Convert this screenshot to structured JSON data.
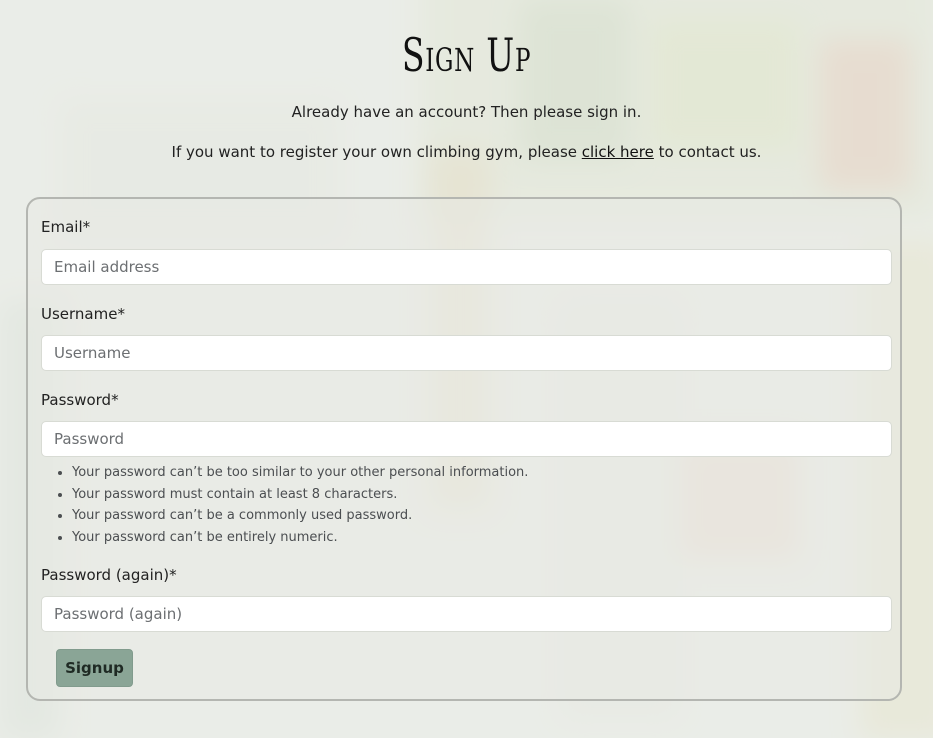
{
  "page": {
    "title": "Sign Up",
    "signin_prompt": "Already have an account? Then please sign in.",
    "gym_prefix": "If you want to register your own climbing gym, please ",
    "gym_link": "click here",
    "gym_suffix": " to contact us."
  },
  "form": {
    "email": {
      "label": "Email*",
      "placeholder": "Email address",
      "value": ""
    },
    "username": {
      "label": "Username*",
      "placeholder": "Username",
      "value": ""
    },
    "password": {
      "label": "Password*",
      "placeholder": "Password",
      "value": ""
    },
    "password_help": [
      "Your password can’t be too similar to your other personal information.",
      "Your password must contain at least 8 characters.",
      "Your password can’t be a commonly used password.",
      "Your password can’t be entirely numeric."
    ],
    "password2": {
      "label": "Password (again)*",
      "placeholder": "Password (again)",
      "value": ""
    },
    "submit_label": "Signup"
  },
  "colors": {
    "button_bg": "#8aa596",
    "card_border": "#b4b6b1",
    "page_bg": "#e7e9e4"
  }
}
